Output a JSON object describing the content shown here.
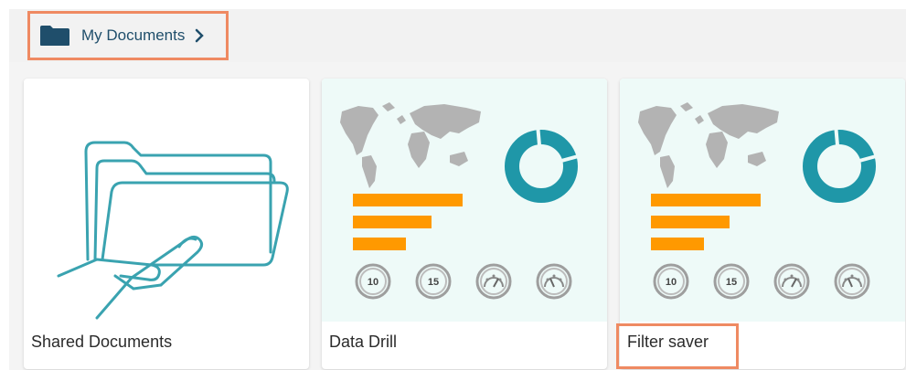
{
  "breadcrumb": {
    "label": "My Documents",
    "icon": "folder-icon",
    "separator": "chevron-right-icon"
  },
  "cards": [
    {
      "title": "Shared Documents",
      "thumbnail": "shared-folder-illustration"
    },
    {
      "title": "Data Drill",
      "thumbnail": "dashboard-preview"
    },
    {
      "title": "Filter saver",
      "thumbnail": "dashboard-preview"
    }
  ],
  "preview": {
    "badges": [
      "10",
      "15"
    ]
  },
  "colors": {
    "accent": "#ef8a62",
    "teal": "#1f97a8",
    "orange": "#ff9900",
    "map_gray": "#b3b3b3",
    "folder_blue": "#1f4e6b"
  }
}
